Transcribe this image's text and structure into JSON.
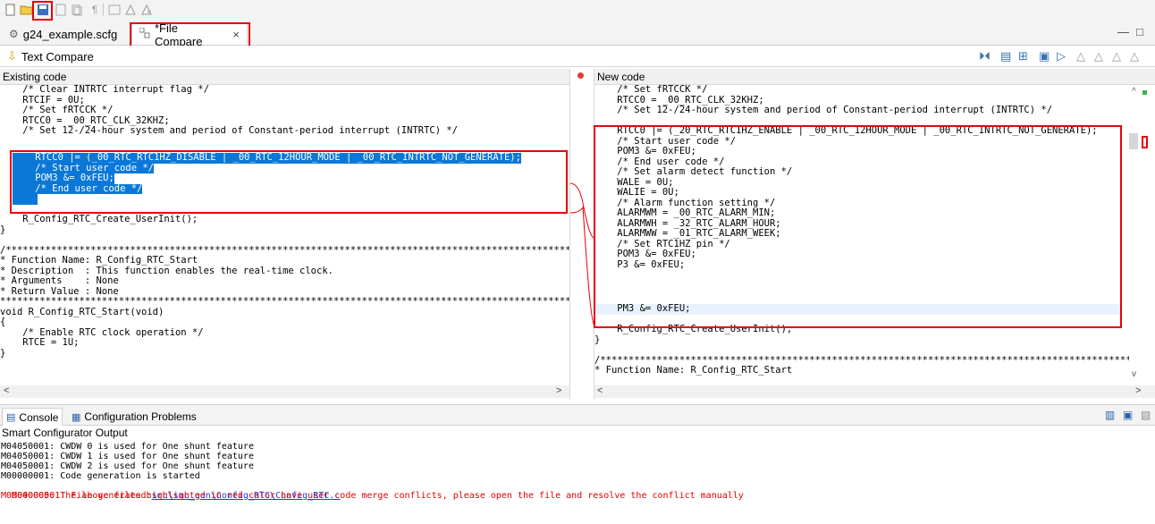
{
  "toolbar": {
    "icons": [
      "new-icon",
      "open-folder-icon",
      "save-icon",
      "page-icon",
      "copy-icon",
      "pilcrow-icon",
      "list-icon",
      "warning-icon",
      "find-icon"
    ]
  },
  "tabs": [
    {
      "label": "g24_example.scfg",
      "icon": "gear-icon"
    },
    {
      "label": "*File Compare",
      "icon": "compare-icon",
      "close": "×"
    }
  ],
  "window_controls": {
    "minimize": "—",
    "maximize": "□"
  },
  "compare": {
    "title": "Text Compare",
    "left_header": "Existing code",
    "right_header": "New code"
  },
  "left_code": [
    "    /* Clear INTRTC interrupt flag */",
    "    RTCIF = 0U;",
    "    /* Set fRTCCK */",
    "    RTCC0 = _00_RTC_CLK_32KHZ;",
    "    /* Set 12-/24-hour system and period of Constant-period interrupt (INTRTC) */",
    "    RTCC0 |= (_00_RTC_RTC1HZ_DISABLE | _00_RTC_12HOUR_MODE | _00_RTC_INTRTC_NOT_GENERATE);",
    "    /* Start user code */",
    "    POM3 &= 0xFEU;",
    "    /* End user code */",
    "",
    "",
    "    R_Config_RTC_Create_UserInit();",
    "}",
    "",
    "/*******************************************************************************************************",
    "* Function Name: R_Config_RTC_Start",
    "* Description  : This function enables the real-time clock.",
    "* Arguments    : None",
    "* Return Value : None",
    "*******************************************************************************************************",
    "void R_Config_RTC_Start(void)",
    "{",
    "    /* Enable RTC clock operation */",
    "    RTCE = 1U;",
    "}"
  ],
  "right_code": [
    "    /* Set fRTCCK */",
    "    RTCC0 = _00_RTC_CLK_32KHZ;",
    "    /* Set 12-/24-hour system and period of Constant-period interrupt (INTRTC) */",
    "    RTCC0 |= (_20_RTC_RTC1HZ_ENABLE | _00_RTC_12HOUR_MODE | _00_RTC_INTRTC_NOT_GENERATE);",
    "    /* Start user code */",
    "    POM3 &= 0xFEU;",
    "    /* End user code */",
    "    /* Set alarm detect function */",
    "    WALE = 0U;",
    "    WALIE = 0U;",
    "    /* Alarm function setting */",
    "    ALARMWM = _00_RTC_ALARM_MIN;",
    "    ALARMWH = _32_RTC_ALARM_HOUR;",
    "    ALARMWW = _01_RTC_ALARM_WEEK;",
    "    /* Set RTC1HZ pin */",
    "    POM3 &= 0xFEU;",
    "    P3 &= 0xFEU;",
    "    PM3 &= 0xFEU;",
    "",
    "    R_Config_RTC_Create_UserInit();",
    "}",
    "",
    "/*******************************************************************************************************",
    "* Function Name: R_Config_RTC_Start"
  ],
  "scroll": {
    "left": "<",
    "right": ">",
    "up": "^",
    "down": "v"
  },
  "console": {
    "tabs": [
      {
        "label": "Console",
        "icon": "console-icon"
      },
      {
        "label": "Configuration Problems",
        "icon": "problems-icon"
      }
    ],
    "title": "Smart Configurator Output",
    "lines": [
      {
        "text": "M04050001: CWDW 0 is used for One shunt feature",
        "red": false
      },
      {
        "text": "M04050001: CWDW 1 is used for One shunt feature",
        "red": false
      },
      {
        "text": "M04050001: CWDW 2 is used for One shunt feature",
        "red": false
      },
      {
        "text": "M00000001: Code generation is started",
        "red": false
      },
      {
        "text": "M04000001: File generated:",
        "red": true,
        "link": "src\\smc_gen\\Config_RTC\\Config_RTC.c"
      },
      {
        "text": "M00000005: The above files highlighted in red color have user code merge conflicts, please open the file and resolve the conflict manually",
        "red": true
      }
    ]
  },
  "colors": {
    "highlight": "#0b78d7",
    "annotation": "#e8000b",
    "error": "#e00000"
  }
}
